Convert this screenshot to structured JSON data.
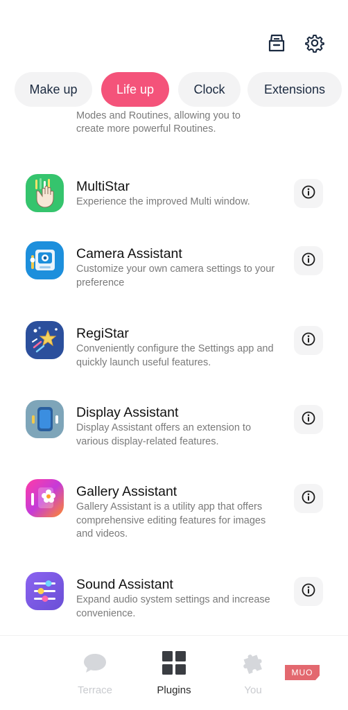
{
  "header": {
    "store_icon": "store-box-icon",
    "settings_icon": "gear-icon"
  },
  "tabs": [
    {
      "label": "Make up",
      "active": false
    },
    {
      "label": "Life up",
      "active": true
    },
    {
      "label": "Clock",
      "active": false
    },
    {
      "label": "Extensions",
      "active": false
    }
  ],
  "partial_item": {
    "desc_line1": "Modes and Routines, allowing you to",
    "desc_line2": "create more powerful Routines."
  },
  "items": [
    {
      "title": "MultiStar",
      "desc": "Experience the improved Multi window.",
      "icon": "multistar-hand-icon",
      "color": "#2fbf6a"
    },
    {
      "title": "Camera Assistant",
      "desc": "Customize your own camera settings to your preference",
      "icon": "camera-assistant-icon",
      "color": "#1e8fd6"
    },
    {
      "title": "RegiStar",
      "desc": "Conveniently configure the Settings app and quickly launch useful features.",
      "icon": "registar-star-icon",
      "color": "#2c4f9e"
    },
    {
      "title": "Display Assistant",
      "desc": "Display Assistant offers an extension to various display-related features.",
      "icon": "display-phone-icon",
      "color": "#7aa3b8"
    },
    {
      "title": "Gallery Assistant",
      "desc": "Gallery Assistant is a utility app that offers comprehensive editing features for images and videos.",
      "icon": "gallery-flower-icon",
      "color": "#e2368c"
    },
    {
      "title": "Sound Assistant",
      "desc": "Expand audio system settings and increase convenience.",
      "icon": "sound-equalizer-icon",
      "color": "#7b5fe0"
    }
  ],
  "bottom_nav": [
    {
      "label": "Terrace",
      "icon": "chat-bubble-icon",
      "active": false
    },
    {
      "label": "Plugins",
      "icon": "grid-icon",
      "active": true
    },
    {
      "label": "You",
      "icon": "puzzle-icon",
      "active": false
    }
  ],
  "watermark": "MUO"
}
